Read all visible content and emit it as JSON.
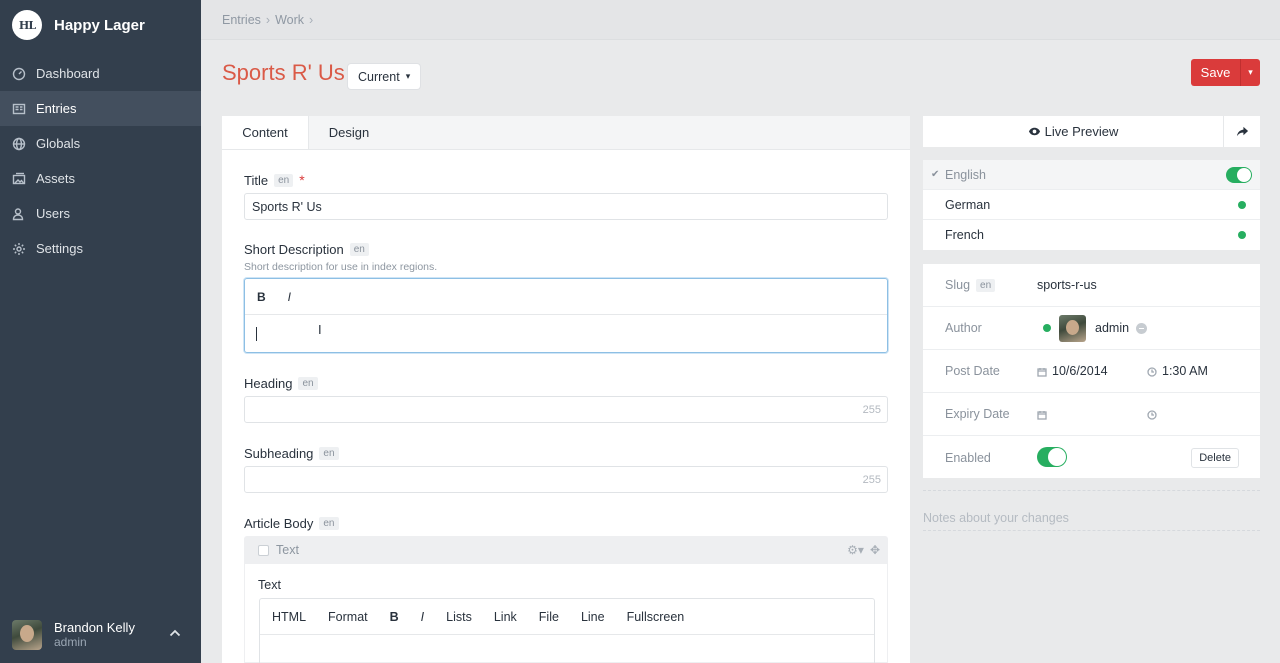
{
  "brand": {
    "initials": "HL",
    "name": "Happy Lager"
  },
  "nav": {
    "items": [
      {
        "label": "Dashboard",
        "icon": "dashboard-icon"
      },
      {
        "label": "Entries",
        "icon": "entries-icon"
      },
      {
        "label": "Globals",
        "icon": "globe-icon"
      },
      {
        "label": "Assets",
        "icon": "assets-icon"
      },
      {
        "label": "Users",
        "icon": "users-icon"
      },
      {
        "label": "Settings",
        "icon": "gear-icon"
      }
    ],
    "active": "Entries"
  },
  "user": {
    "name": "Brandon Kelly",
    "role": "admin"
  },
  "breadcrumb": [
    "Entries",
    "Work"
  ],
  "page": {
    "title": "Sports R' Us",
    "revision": "Current",
    "save_label": "Save"
  },
  "tabs": [
    "Content",
    "Design"
  ],
  "fields": {
    "title": {
      "label": "Title",
      "lang": "en",
      "value": "Sports R' Us"
    },
    "short_description": {
      "label": "Short Description",
      "lang": "en",
      "instructions": "Short description for use in index regions.",
      "toolbar": [
        "B",
        "I"
      ]
    },
    "heading": {
      "label": "Heading",
      "lang": "en",
      "count": "255"
    },
    "subheading": {
      "label": "Subheading",
      "lang": "en",
      "count": "255"
    },
    "article_body": {
      "label": "Article Body",
      "lang": "en",
      "block_type": "Text",
      "field_label": "Text",
      "toolbar": [
        "HTML",
        "Format",
        "B",
        "I",
        "Lists",
        "Link",
        "File",
        "Line",
        "Fullscreen"
      ]
    }
  },
  "preview": {
    "label": "Live Preview"
  },
  "locales": [
    {
      "name": "English",
      "selected": true
    },
    {
      "name": "German",
      "selected": false
    },
    {
      "name": "French",
      "selected": false
    }
  ],
  "meta": {
    "slug": {
      "label": "Slug",
      "lang": "en",
      "value": "sports-r-us"
    },
    "author": {
      "label": "Author",
      "value": "admin"
    },
    "post_date": {
      "label": "Post Date",
      "date": "10/6/2014",
      "time": "1:30 AM"
    },
    "expiry_date": {
      "label": "Expiry Date"
    },
    "enabled": {
      "label": "Enabled",
      "delete_label": "Delete"
    }
  },
  "notes": {
    "placeholder": "Notes about your changes"
  },
  "colors": {
    "accent": "#da5a47",
    "save": "#da3b3b",
    "sidebar": "#333f4d",
    "enabled": "#27ae60"
  }
}
